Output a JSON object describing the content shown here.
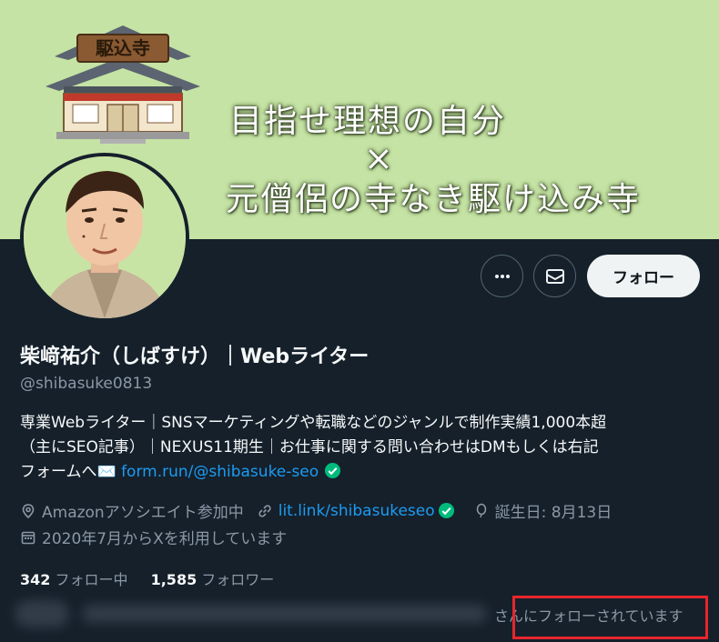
{
  "banner": {
    "temple_sign": "駆込寺",
    "line1": "目指せ理想の自分",
    "line2": "×",
    "line3": "元僧侶の寺なき駆け込み寺"
  },
  "actions": {
    "more_icon": "more-icon",
    "message_icon": "envelope-icon",
    "follow_label": "フォロー"
  },
  "profile": {
    "name": "柴﨑祐介（しばすけ）｜Webライター",
    "handle": "@shibasuke0813",
    "bio_line1": "専業Webライター｜SNSマーケティングや転職などのジャンルで制作実績1,000本超",
    "bio_line2": "（主にSEO記事）｜NEXUS11期生｜お仕事に関する問い合わせはDMもしくは右記",
    "bio_line3_prefix": "フォームへ✉️ ",
    "bio_link": "form.run/@shibasuke-seo"
  },
  "meta": {
    "category": "Amazonアソシエイト参加中",
    "website": "lit.link/shibasukeseo",
    "birthday": "誕生日: 8月13日",
    "joined": "2020年7月からXを利用しています"
  },
  "stats": {
    "following_count": "342",
    "following_label": " フォロー中",
    "followers_count": "1,585",
    "followers_label": " フォロワー"
  },
  "followed_by": {
    "text_partial": "さんにフォローされています"
  },
  "colors": {
    "background": "#15202b",
    "banner": "#c5e3a4",
    "link": "#1d9bf0",
    "verified": "#00ba7c",
    "highlight": "#e8262b"
  }
}
